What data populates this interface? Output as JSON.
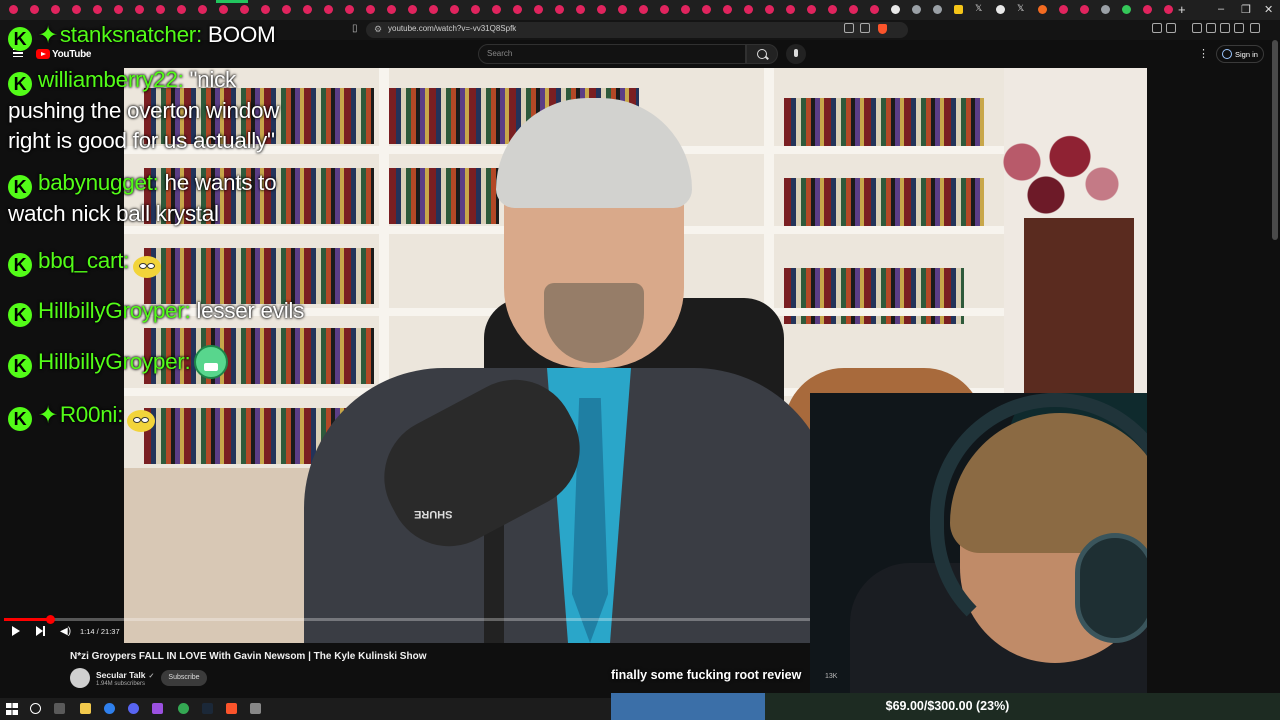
{
  "browser": {
    "url": "youtube.com/watch?v=-vv31Q8Spfk",
    "tab_icons": [
      "rec",
      "rec",
      "rec",
      "rec",
      "rec",
      "rec",
      "rec",
      "rec",
      "rec",
      "rec",
      "rec",
      "rec",
      "rec",
      "rec",
      "rec",
      "rec",
      "rec",
      "rec",
      "rec",
      "rec",
      "rec",
      "rec",
      "rec",
      "rec",
      "rec",
      "rec",
      "rec",
      "rec",
      "rec",
      "rec",
      "rec",
      "rec",
      "rec",
      "rec",
      "rec",
      "rec",
      "rec",
      "rec",
      "rec",
      "rec",
      "rec",
      "rec",
      "white",
      "gray",
      "gray",
      "yellow",
      "x",
      "white",
      "x",
      "orange",
      "rec",
      "rec",
      "gray",
      "green",
      "rec",
      "rec"
    ],
    "window_controls": [
      "–",
      "❐",
      "✕"
    ],
    "new_tab": "+"
  },
  "youtube": {
    "logo_text": "YouTube",
    "search_placeholder": "Search",
    "signin_label": "Sign in",
    "more_icon": "⋮"
  },
  "chat": {
    "badge_letter": "K",
    "messages": [
      {
        "user": "stanksnatcher:",
        "text": "BOOM",
        "diamond": true
      },
      {
        "user": "williamberry22:",
        "text": "\"nick",
        "cont": [
          "pushing the overton window",
          "right is good for us actually\""
        ]
      },
      {
        "user": "babynugget:",
        "text": "he wants to",
        "cont": [
          "watch nick ball krystal"
        ]
      },
      {
        "user": "bbq_cart:",
        "text": "",
        "emote": "yellow-face"
      },
      {
        "user": "HillbillyGroyper:",
        "text": "lesser evils"
      },
      {
        "user": "HillbillyGroyper:",
        "text": "",
        "emote": "green-face"
      },
      {
        "user": "R00ni:",
        "text": "",
        "diamond": true,
        "emote": "yellow-face"
      }
    ]
  },
  "player": {
    "time_display": "1:14 / 21:37",
    "progress_fraction": 0.057,
    "mic_brand": "SHURE"
  },
  "video": {
    "title": "N*zi Groypers FALL IN LOVE With Gavin Newsom | The Kyle Kulinski Show",
    "channel": "Secular Talk",
    "verified": "✓",
    "subscribers": "1.94M subscribers",
    "subscribe_label": "Subscribe",
    "like_count": "13K"
  },
  "stream": {
    "caption": "finally some fucking root review",
    "goal_text": "$69.00/$300.00 (23%)",
    "goal_fraction": 0.23
  },
  "colors": {
    "kick_green": "#53fc18",
    "yt_red": "#ff0000",
    "goal_fill": "#3b6fa8"
  }
}
